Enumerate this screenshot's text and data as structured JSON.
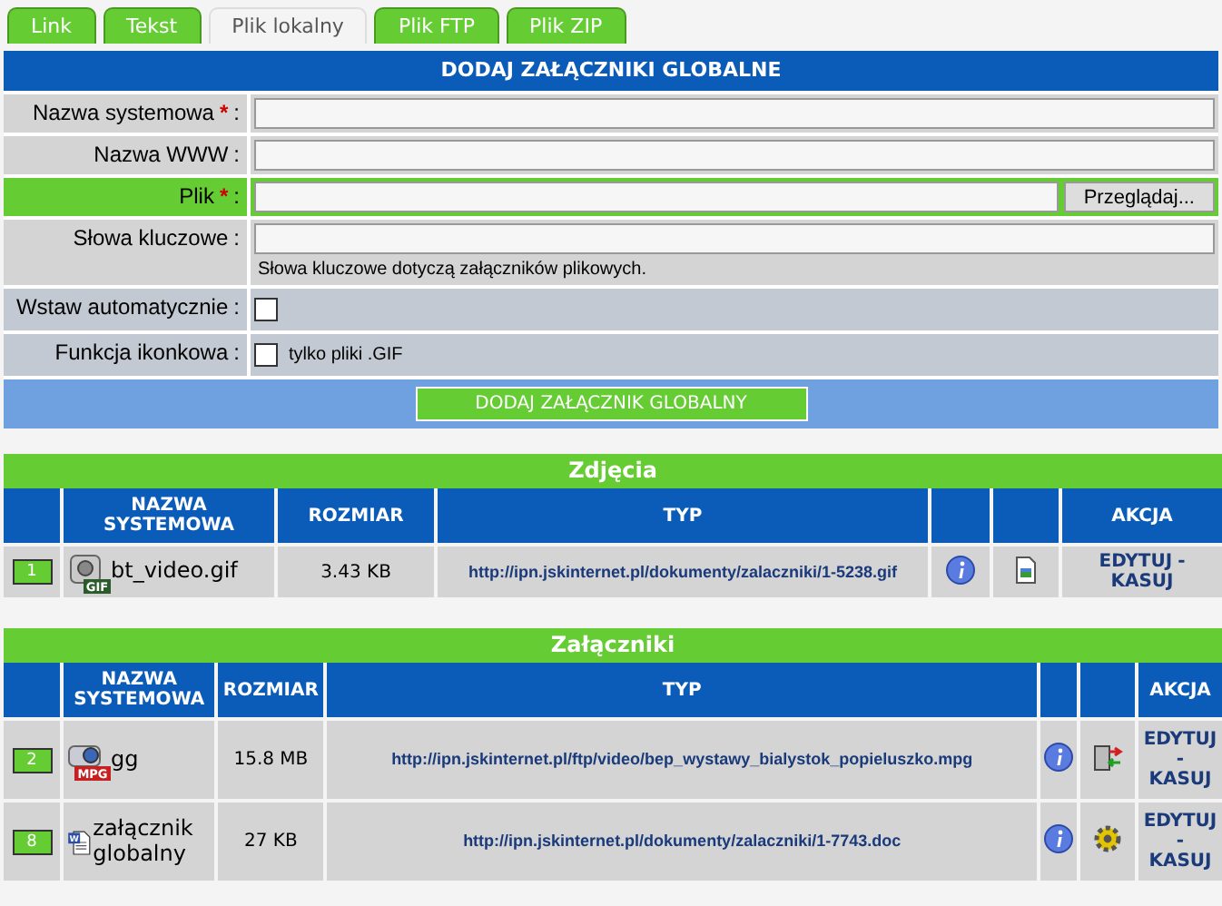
{
  "tabs": [
    {
      "label": "Link",
      "selected": false
    },
    {
      "label": "Tekst",
      "selected": false
    },
    {
      "label": "Plik lokalny",
      "selected": true
    },
    {
      "label": "Plik FTP",
      "selected": false
    },
    {
      "label": "Plik ZIP",
      "selected": false
    }
  ],
  "form": {
    "title": "DODAJ ZAŁĄCZNIKI GLOBALNE",
    "fields": [
      {
        "kind": "text",
        "label": "Nazwa systemowa",
        "required_mark": "*",
        "colon": ":",
        "highlighted": false
      },
      {
        "kind": "text",
        "label": "Nazwa WWW",
        "colon": ":",
        "highlighted": false
      },
      {
        "kind": "file",
        "label": "Plik",
        "required_mark": "*",
        "colon": ":",
        "highlighted": true,
        "button": "Przeglądaj..."
      },
      {
        "kind": "text",
        "label": "Słowa kluczowe",
        "colon": ":",
        "highlighted": false,
        "hint": "Słowa kluczowe dotyczą załączników plikowych."
      },
      {
        "kind": "checkbox",
        "label": "Wstaw automatycznie",
        "colon": ":",
        "highlighted": false,
        "checked": false
      },
      {
        "kind": "checkbox",
        "label": "Funkcja ikonkowa",
        "colon": ":",
        "highlighted": false,
        "checked": false,
        "note": "tylko pliki .GIF"
      }
    ],
    "submit": "DODAJ ZAŁĄCZNIK GLOBALNY"
  },
  "sections": [
    {
      "title": "Zdjęcia",
      "columns": {
        "name": "NAZWA SYSTEMOWA",
        "size": "ROZMIAR",
        "type": "TYP",
        "action": "AKCJA"
      },
      "rows": [
        {
          "number": "1",
          "file_icon": {
            "kind": "image",
            "badge": "GIF"
          },
          "name": "bt_video.gif",
          "size": "3.43 KB",
          "url": "http://ipn.jskinternet.pl/dokumenty/zalaczniki/1-5238.gif",
          "tool_icon": {
            "kind": "picture"
          },
          "edit": "EDYTUJ",
          "separator": "-",
          "delete": "KASUJ"
        }
      ]
    },
    {
      "title": "Załączniki",
      "columns": {
        "name": "NAZWA SYSTEMOWA",
        "size": "ROZMIAR",
        "type": "TYP",
        "action": "AKCJA"
      },
      "rows": [
        {
          "number": "2",
          "file_icon": {
            "kind": "video",
            "badge": "MPG"
          },
          "name": "gg",
          "size": "15.8 MB",
          "url": "http://ipn.jskinternet.pl/ftp/video/bep_wystawy_bialystok_popieluszko.mpg",
          "tool_icon": {
            "kind": "transfer"
          },
          "edit": "EDYTUJ",
          "separator": "-",
          "delete": "KASUJ"
        },
        {
          "number": "8",
          "file_icon": {
            "kind": "document",
            "badge": "W"
          },
          "name": "załącznik globalny",
          "size": "27 KB",
          "url": "http://ipn.jskinternet.pl/dokumenty/zalaczniki/1-7743.doc",
          "tool_icon": {
            "kind": "gear"
          },
          "edit": "EDYTUJ",
          "separator": "-",
          "delete": "KASUJ"
        }
      ]
    }
  ]
}
